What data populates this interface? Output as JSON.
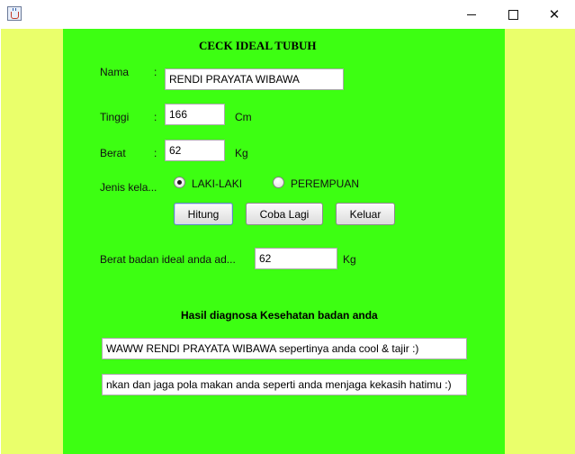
{
  "window": {
    "minimize_icon": "minimize-icon",
    "maximize_icon": "maximize-icon",
    "close_icon": "close-icon",
    "close_glyph": "✕"
  },
  "colors": {
    "side_background": "#eaff6b",
    "panel_background": "#3dff12"
  },
  "form": {
    "title": "CECK IDEAL TUBUH",
    "nama_label": "Nama",
    "tinggi_label": "Tinggi",
    "berat_label": "Berat",
    "colon": ":",
    "nama_value": "RENDI PRAYATA WIBAWA",
    "tinggi_value": "166",
    "tinggi_unit": "Cm",
    "berat_value": "62",
    "berat_unit": "Kg",
    "jenis_label": "Jenis kela...",
    "radio_male": "LAKI-LAKI",
    "radio_female": "PEREMPUAN",
    "selected_gender": "LAKI-LAKI"
  },
  "buttons": {
    "hitung": "Hitung",
    "coba_lagi": "Coba Lagi",
    "keluar": "Keluar"
  },
  "result": {
    "ideal_label": "Berat badan ideal anda ad...",
    "ideal_value": "62",
    "ideal_unit": "Kg",
    "diagnosis_heading": "Hasil diagnosa Kesehatan badan anda",
    "diagnosis_line1": "WAWW RENDI PRAYATA WIBAWA sepertinya anda cool & tajir :)",
    "diagnosis_line2": "nkan dan jaga pola makan anda seperti anda menjaga kekasih hatimu :)"
  }
}
